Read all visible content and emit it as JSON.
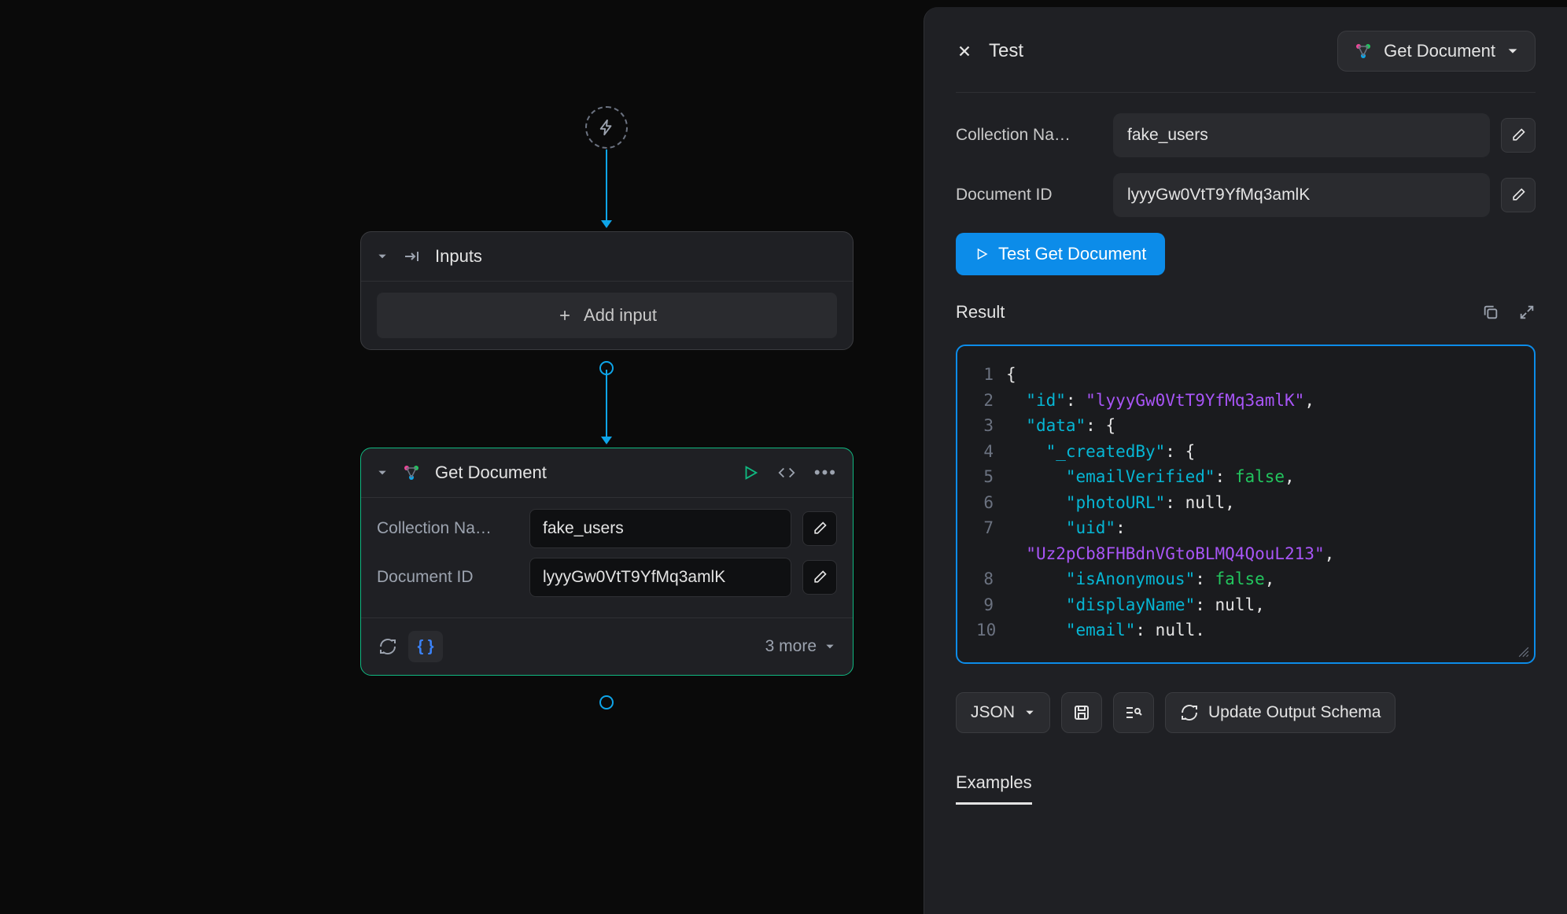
{
  "canvas": {
    "inputs_node": {
      "title": "Inputs",
      "add_label": "Add input"
    },
    "getdoc_node": {
      "title": "Get Document",
      "fields": {
        "collection_label": "Collection Na…",
        "collection_value": "fake_users",
        "docid_label": "Document ID",
        "docid_value": "lyyyGw0VtT9YfMq3amlK"
      },
      "footer_more": "3 more"
    }
  },
  "panel": {
    "title": "Test",
    "node_pill": "Get Document",
    "fields": {
      "collection_label": "Collection Na…",
      "collection_value": "fake_users",
      "docid_label": "Document ID",
      "docid_value": "lyyyGw0VtT9YfMq3amlK"
    },
    "test_button": "Test Get Document",
    "result_label": "Result",
    "json_dropdown": "JSON",
    "update_schema": "Update Output Schema",
    "tab_examples": "Examples",
    "code": {
      "lines": [
        {
          "n": "1",
          "pre": "",
          "seg": [
            [
              "brace",
              "{"
            ]
          ]
        },
        {
          "n": "2",
          "pre": "  ",
          "seg": [
            [
              "key",
              "\"id\""
            ],
            [
              "punct",
              ": "
            ],
            [
              "string",
              "\"lyyyGw0VtT9YfMq3amlK\""
            ],
            [
              "punct",
              ","
            ]
          ]
        },
        {
          "n": "3",
          "pre": "  ",
          "seg": [
            [
              "key",
              "\"data\""
            ],
            [
              "punct",
              ": "
            ],
            [
              "brace",
              "{"
            ]
          ]
        },
        {
          "n": "4",
          "pre": "    ",
          "seg": [
            [
              "key",
              "\"_createdBy\""
            ],
            [
              "punct",
              ": "
            ],
            [
              "brace",
              "{"
            ]
          ]
        },
        {
          "n": "5",
          "pre": "      ",
          "seg": [
            [
              "key",
              "\"emailVerified\""
            ],
            [
              "punct",
              ": "
            ],
            [
              "bool",
              "false"
            ],
            [
              "punct",
              ","
            ]
          ]
        },
        {
          "n": "6",
          "pre": "      ",
          "seg": [
            [
              "key",
              "\"photoURL\""
            ],
            [
              "punct",
              ": "
            ],
            [
              "null",
              "null"
            ],
            [
              "punct",
              ","
            ]
          ]
        },
        {
          "n": "7",
          "pre": "      ",
          "seg": [
            [
              "key",
              "\"uid\""
            ],
            [
              "punct",
              ":"
            ]
          ]
        },
        {
          "n": "",
          "pre": "  ",
          "seg": [
            [
              "string",
              "\"Uz2pCb8FHBdnVGtoBLMQ4QouL213\""
            ],
            [
              "punct",
              ","
            ]
          ]
        },
        {
          "n": "8",
          "pre": "      ",
          "seg": [
            [
              "key",
              "\"isAnonymous\""
            ],
            [
              "punct",
              ": "
            ],
            [
              "bool",
              "false"
            ],
            [
              "punct",
              ","
            ]
          ]
        },
        {
          "n": "9",
          "pre": "      ",
          "seg": [
            [
              "key",
              "\"displayName\""
            ],
            [
              "punct",
              ": "
            ],
            [
              "null",
              "null"
            ],
            [
              "punct",
              ","
            ]
          ]
        },
        {
          "n": "10",
          "pre": "      ",
          "seg": [
            [
              "key",
              "\"email\""
            ],
            [
              "punct",
              ": "
            ],
            [
              "null",
              "null"
            ],
            [
              "punct",
              "."
            ]
          ]
        }
      ]
    }
  }
}
